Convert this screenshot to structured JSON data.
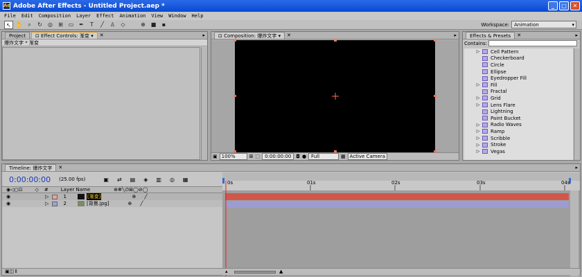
{
  "window": {
    "title": "Adobe After Effects - Untitled Project.aep *",
    "btn_min": "_",
    "btn_max": "□",
    "btn_close": "✕"
  },
  "menu": [
    "File",
    "Edit",
    "Composition",
    "Layer",
    "Effect",
    "Animation",
    "View",
    "Window",
    "Help"
  ],
  "workspace": {
    "label": "Workspace:",
    "value": "Animation"
  },
  "project_panel": {
    "tab_project": "Project",
    "tab_effects": "Effect Controls: 渐变",
    "breadcrumb": "爆炸文字 * 渐变"
  },
  "comp_panel": {
    "tab": "Composition: 爆炸文字",
    "zoom": "100%",
    "timecode": "0:00:00:00",
    "resolution": "Full",
    "camera": "Active Camera"
  },
  "effects_panel": {
    "tab": "Effects & Presets",
    "contains_label": "Contains:",
    "items": [
      {
        "label": "Cell Pattern",
        "expand": true
      },
      {
        "label": "Checkerboard",
        "expand": false
      },
      {
        "label": "Circle",
        "expand": false
      },
      {
        "label": "Ellipse",
        "expand": false
      },
      {
        "label": "Eyedropper Fill",
        "expand": false
      },
      {
        "label": "Fill",
        "expand": true
      },
      {
        "label": "Fractal",
        "expand": false
      },
      {
        "label": "Grid",
        "expand": true
      },
      {
        "label": "Lens Flare",
        "expand": true
      },
      {
        "label": "Lightning",
        "expand": false
      },
      {
        "label": "Paint Bucket",
        "expand": false
      },
      {
        "label": "Radio Waves",
        "expand": true
      },
      {
        "label": "Ramp",
        "expand": true
      },
      {
        "label": "Scribble",
        "expand": true
      },
      {
        "label": "Stroke",
        "expand": true
      },
      {
        "label": "Vegas",
        "expand": true
      }
    ]
  },
  "timeline": {
    "tab": "Timeline: 爆炸文字",
    "timecode": "0:00:00:00",
    "fps": "(25.00 fps)",
    "col_hash": "#",
    "col_layer_name": "Layer Name",
    "ruler": [
      "0s",
      "01s",
      "02s",
      "03s",
      "04s"
    ],
    "layers": [
      {
        "num": "1",
        "name": "[渐变]",
        "color": "#e8a0a0",
        "bar_color": "#d0584a"
      },
      {
        "num": "2",
        "name": "[背景.jpg]",
        "color": "#a0a0d8",
        "bar_color": "#9c9cd0"
      }
    ]
  }
}
